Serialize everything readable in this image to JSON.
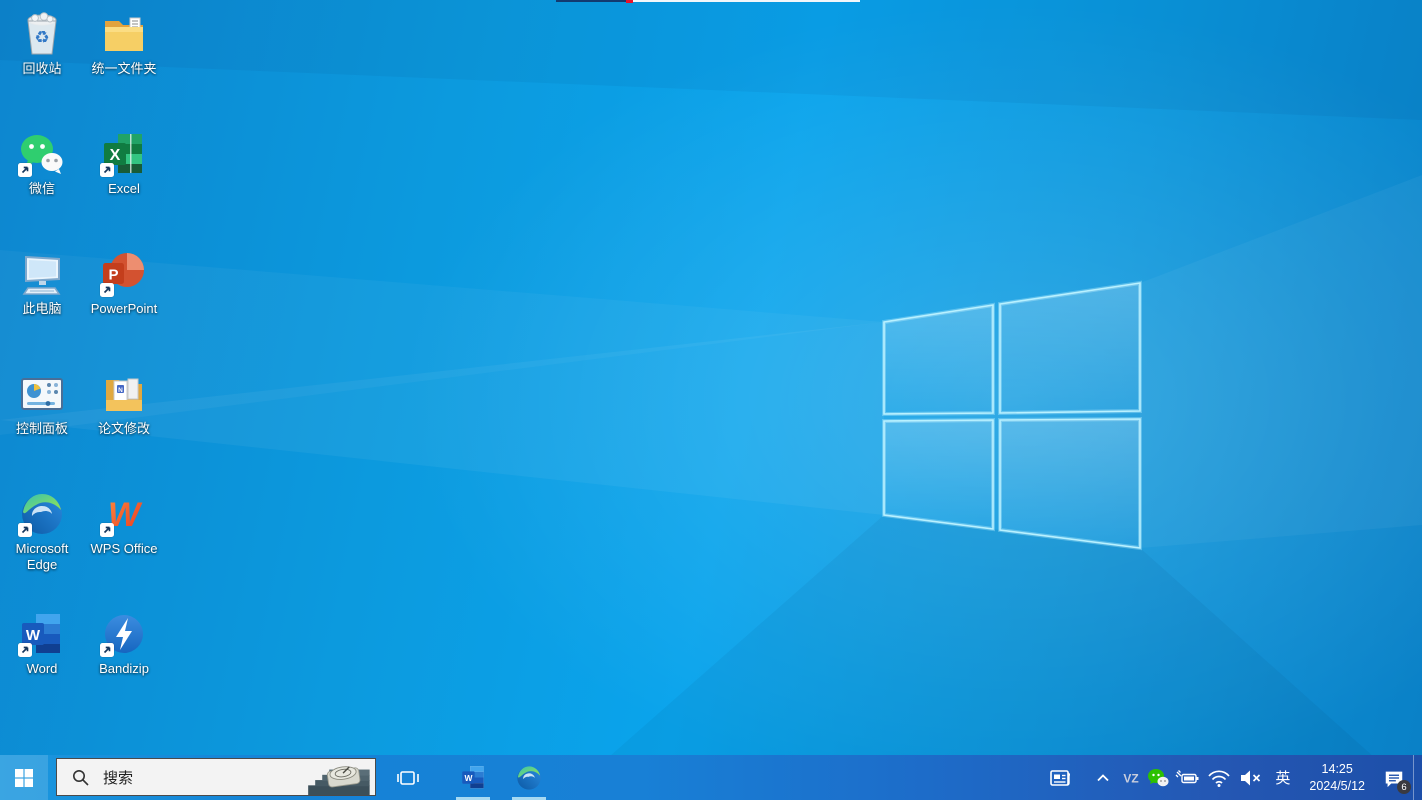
{
  "wallpaper": {
    "base_color": "#0aa0e8",
    "logo": "windows-10-light-logo"
  },
  "desktop": {
    "icons": [
      {
        "label": "回收站",
        "name": "recycle-bin",
        "shortcut": false
      },
      {
        "label": "统一文件夹",
        "name": "unified-folder",
        "shortcut": false
      },
      {
        "label": "微信",
        "name": "wechat",
        "shortcut": true
      },
      {
        "label": "Excel",
        "name": "excel",
        "shortcut": true
      },
      {
        "label": "此电脑",
        "name": "this-pc",
        "shortcut": false
      },
      {
        "label": "PowerPoint",
        "name": "powerpoint",
        "shortcut": true
      },
      {
        "label": "控制面板",
        "name": "control-panel",
        "shortcut": false
      },
      {
        "label": "论文修改",
        "name": "thesis-edit-folder",
        "shortcut": false
      },
      {
        "label": "Microsoft Edge",
        "name": "microsoft-edge",
        "shortcut": true
      },
      {
        "label": "WPS Office",
        "name": "wps-office",
        "shortcut": true
      },
      {
        "label": "Word",
        "name": "word",
        "shortcut": true
      },
      {
        "label": "Bandizip",
        "name": "bandizip",
        "shortcut": true
      }
    ]
  },
  "taskbar": {
    "accent_color": "#1583d7",
    "start_icon": "windows-start-icon",
    "search": {
      "placeholder": "搜索",
      "icon": "search-icon",
      "highlight_graphic": "sundial-on-steps"
    },
    "buttons": [
      "task-view",
      "word",
      "edge"
    ],
    "running_apps": [
      "word",
      "edge"
    ],
    "tray_icons": [
      "news-and-interests-icon",
      "hidden-icons-chevron",
      "vz-app-icon",
      "wechat-tray-icon",
      "battery-charging-icon",
      "wifi-icon",
      "volume-muted-icon"
    ],
    "ime": "英",
    "clock": {
      "time": "14:25",
      "date": "2024/5/12"
    },
    "action_center_badge": "6"
  }
}
